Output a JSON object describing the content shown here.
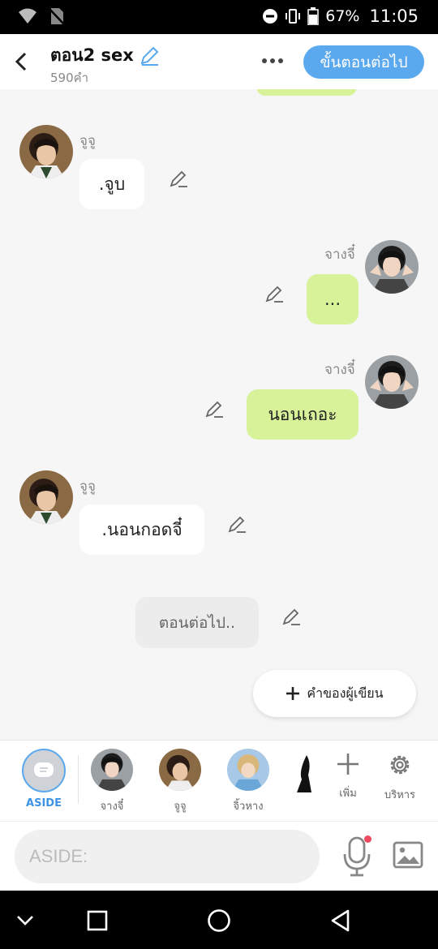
{
  "status_bar": {
    "battery": "67%",
    "time": "11:05"
  },
  "header": {
    "title": "ตอน2 sex",
    "word_count": "590คำ",
    "next_button": "ขั้นตอนต่อไป"
  },
  "messages": [
    {
      "sender": "จูจู",
      "text": ".จูบ",
      "side": "left"
    },
    {
      "sender": "จางจี๋",
      "text": "...",
      "side": "right"
    },
    {
      "sender": "จางจี๋",
      "text": "นอนเถอะ",
      "side": "right"
    },
    {
      "sender": "จูจู",
      "text": ".นอนกอดจี๋",
      "side": "left"
    },
    {
      "sender": "",
      "text": "ตอนต่อไป..",
      "side": "center"
    }
  ],
  "add_note": {
    "label": "คำของผู้เขียน"
  },
  "character_bar": {
    "aside_label": "ASIDE",
    "characters": [
      {
        "name": "จางจี๋"
      },
      {
        "name": "จูจู"
      },
      {
        "name": "จิ้วหาง"
      }
    ],
    "add_label": "เพิ่ม",
    "manage_label": "บริหาร"
  },
  "input": {
    "placeholder": "ASIDE:"
  },
  "colors": {
    "accent": "#5aa9ee",
    "bubble_right": "#d8f29a",
    "bubble_left": "#ffffff",
    "mic_dot": "#ee4a5e"
  }
}
